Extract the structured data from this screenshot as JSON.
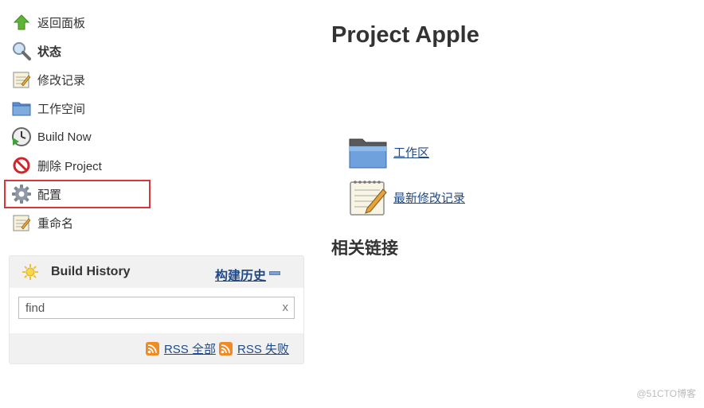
{
  "sidebar": {
    "items": [
      {
        "label": "返回面板",
        "icon": "up-arrow-icon"
      },
      {
        "label": "状态",
        "icon": "magnifier-icon"
      },
      {
        "label": "修改记录",
        "icon": "notepad-icon"
      },
      {
        "label": "工作空间",
        "icon": "folder-icon"
      },
      {
        "label": "Build Now",
        "icon": "clock-play-icon"
      },
      {
        "label": "删除 Project",
        "icon": "no-entry-icon"
      },
      {
        "label": "配置",
        "icon": "gear-icon"
      },
      {
        "label": "重命名",
        "icon": "notepad-icon"
      }
    ]
  },
  "build_history": {
    "title": "Build History",
    "trend_label": "构建历史",
    "search_placeholder": "find",
    "search_value": "find",
    "clear_label": "x",
    "rss_all": "RSS 全部",
    "rss_failed": "RSS 失败"
  },
  "main": {
    "title": "Project Apple",
    "links": [
      {
        "label": "工作区",
        "icon": "folder-icon"
      },
      {
        "label": "最新修改记录",
        "icon": "notepad-icon"
      }
    ],
    "related_links_title": "相关链接"
  },
  "watermark": "@51CTO博客",
  "colors": {
    "link": "#204a87",
    "highlight": "#d9353a",
    "panel_bg": "#f1f1f1"
  }
}
